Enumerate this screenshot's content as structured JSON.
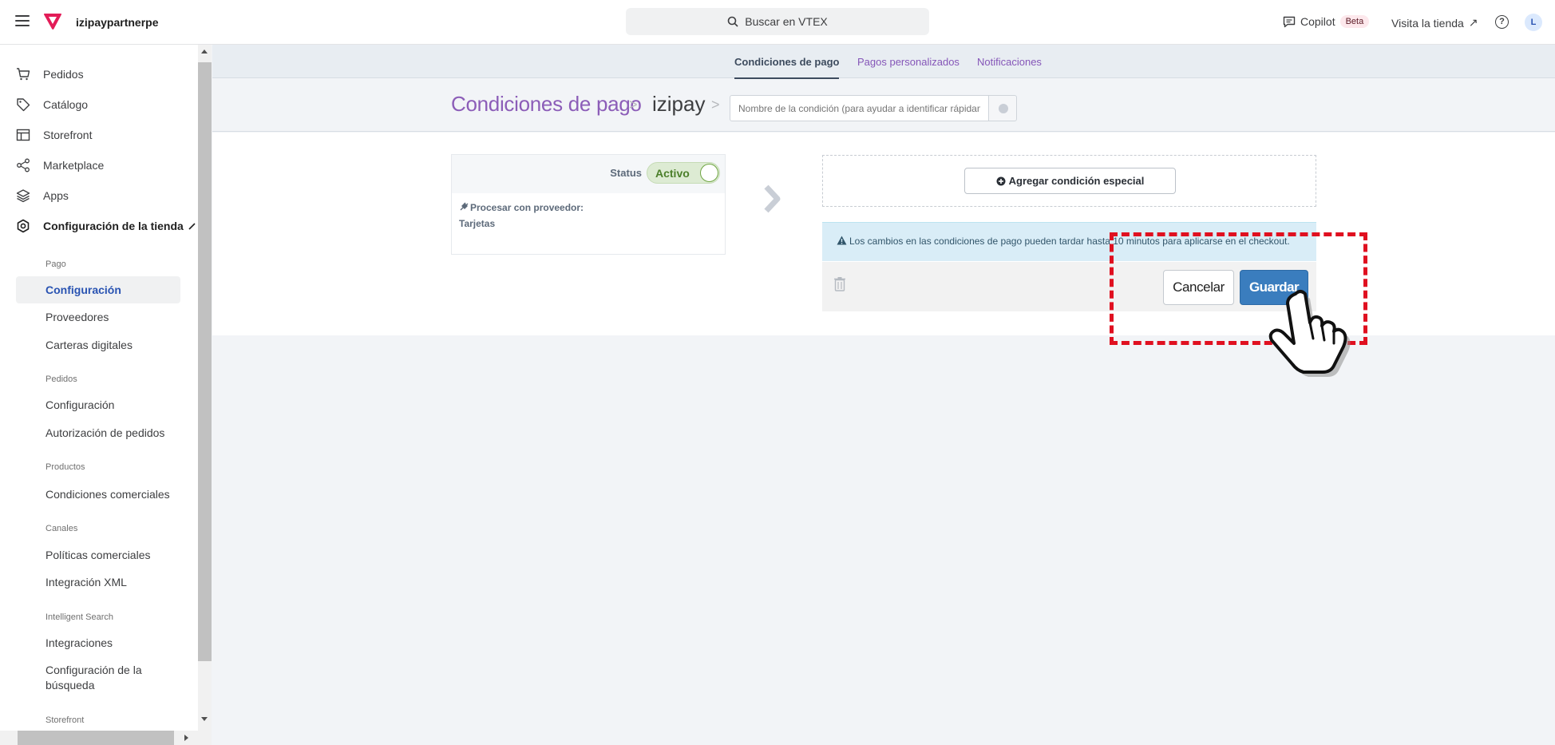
{
  "topbar": {
    "store_name": "izipaypartnerpe",
    "search_placeholder": "Buscar en VTEX",
    "copilot_label": "Copilot",
    "beta_badge": "Beta",
    "visit_store": "Visita la tienda",
    "avatar_initial": "L",
    "help_glyph": "?",
    "visit_arrow": "↗"
  },
  "sidebar": {
    "main_items": [
      {
        "label": "Pedidos",
        "icon": "cart-icon"
      },
      {
        "label": "Catálogo",
        "icon": "tag-icon"
      },
      {
        "label": "Storefront",
        "icon": "layout-icon"
      },
      {
        "label": "Marketplace",
        "icon": "share-icon"
      },
      {
        "label": "Apps",
        "icon": "layers-icon"
      },
      {
        "label": "Configuración de la tienda",
        "icon": "gear-icon"
      }
    ],
    "sections": [
      {
        "heading": "Pago",
        "items": [
          "Configuración",
          "Proveedores",
          "Carteras digitales"
        ]
      },
      {
        "heading": "Pedidos",
        "items": [
          "Configuración",
          "Autorización de pedidos"
        ]
      },
      {
        "heading": "Productos",
        "items": [
          "Condiciones comerciales"
        ]
      },
      {
        "heading": "Canales",
        "items": [
          "Políticas comerciales",
          "Integración XML"
        ]
      },
      {
        "heading": "Intelligent Search",
        "items": [
          "Integraciones",
          "Configuración de la",
          "búsqueda"
        ]
      },
      {
        "heading": "Storefront",
        "items": []
      }
    ]
  },
  "tabs": [
    "Condiciones de pago",
    "Pagos personalizados",
    "Notificaciones"
  ],
  "header": {
    "breadcrumb_root": "Condiciones de pago",
    "breadcrumb_current": "izipay",
    "separator": ">",
    "condition_name_placeholder": "Nombre de la condición (para ayudar a identificar rápidamente)"
  },
  "status_card": {
    "status_label": "Status",
    "toggle_label": "Activo",
    "processor_label": "Procesar con proveedor:",
    "processor_value": "Tarjetas"
  },
  "special": {
    "add_button": "Agregar condición especial"
  },
  "alert": {
    "text": "Los cambios en las condiciones de pago pueden tardar hasta 10 minutos para aplicarse en el checkout."
  },
  "actions": {
    "cancel": "Cancelar",
    "save": "Guardar"
  },
  "colors": {
    "accent_purple": "#8c5db8",
    "save_blue": "#3a7dbe",
    "alert_bg": "#d9edf7",
    "highlight_red": "#e01020",
    "toggle_green": "#4b7f2a"
  }
}
